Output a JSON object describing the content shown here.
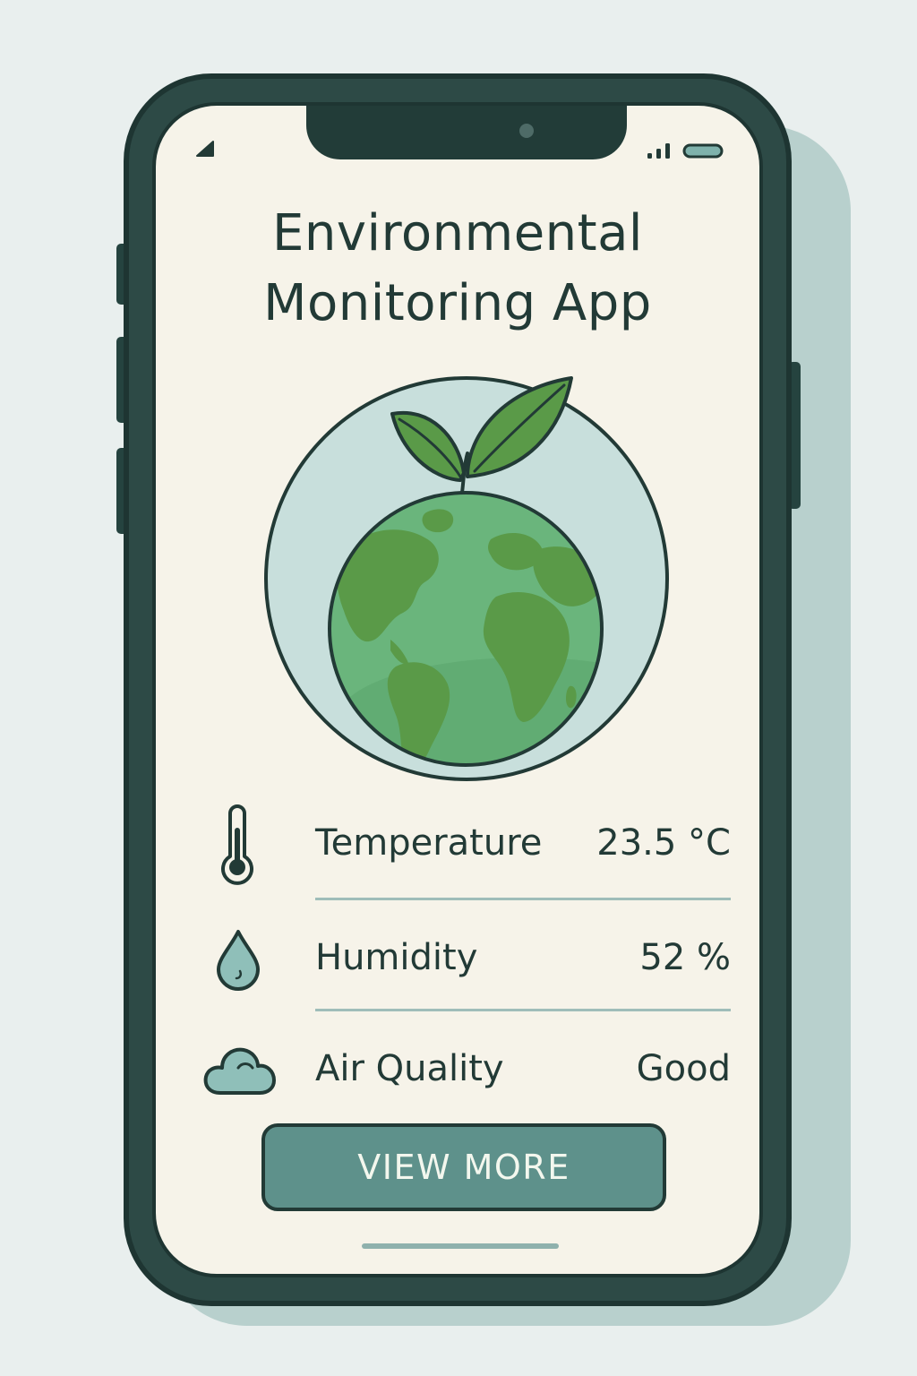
{
  "app": {
    "title_line1": "Environmental",
    "title_line2": "Monitoring App"
  },
  "status_bar": {
    "icons": [
      "location-arrow-icon",
      "signal-bars-icon",
      "battery-icon"
    ]
  },
  "hero": {
    "icon": "earth-sprout-icon"
  },
  "readings": [
    {
      "label": "Temperature",
      "value": "23.5 °C",
      "icon": "thermometer-icon"
    },
    {
      "label": "Humidity",
      "value": "52 %",
      "icon": "water-drop-icon"
    },
    {
      "label": "Air Quality",
      "value": "Good",
      "icon": "cloud-icon"
    }
  ],
  "actions": {
    "view_more_label": "VIEW MORE"
  },
  "colors": {
    "frame": "#2d4a46",
    "screen": "#f6f3e9",
    "accent": "#5e918b",
    "earth_green": "#6ab57c",
    "land_green": "#5a9a48",
    "leaf_green": "#5a9a48",
    "text": "#223a36"
  }
}
